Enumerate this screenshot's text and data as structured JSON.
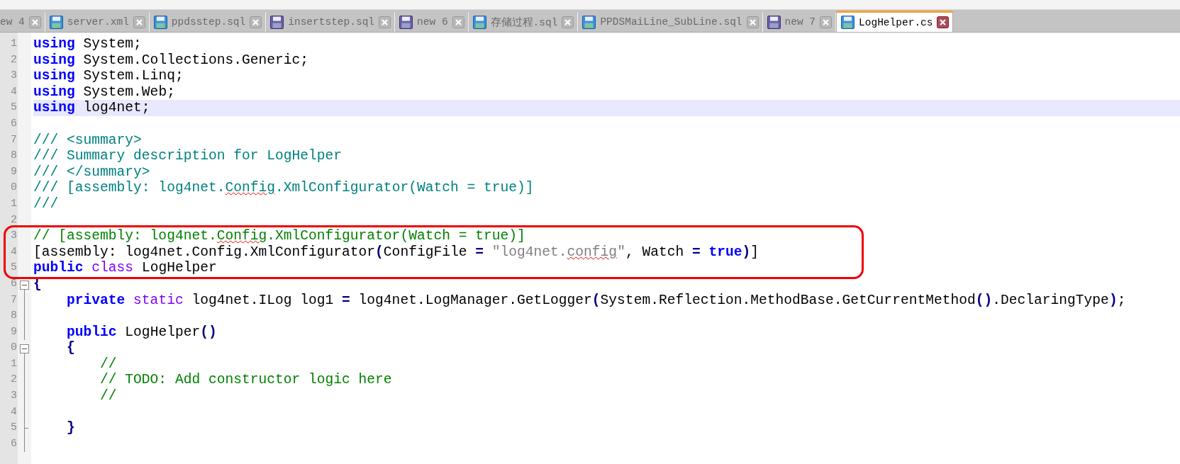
{
  "tabs": [
    {
      "label": "ew 4",
      "selected": false
    },
    {
      "label": "server.xml",
      "selected": false,
      "unsaved": false
    },
    {
      "label": "ppdsstep.sql",
      "selected": false,
      "unsaved": false
    },
    {
      "label": "insertstep.sql",
      "selected": false,
      "unsaved": true
    },
    {
      "label": "new 6",
      "selected": false,
      "unsaved": true
    },
    {
      "label": "存储过程.sql",
      "selected": false,
      "unsaved": false
    },
    {
      "label": "PPDSMaiLine_SubLine.sql",
      "selected": false,
      "unsaved": false
    },
    {
      "label": "new 7",
      "selected": false,
      "unsaved": true
    },
    {
      "label": "LogHelper.cs",
      "selected": true,
      "unsaved": false
    }
  ],
  "editor": {
    "lines": [
      {
        "number": "1",
        "tokens": [
          {
            "kind": "keyword",
            "text": "using"
          },
          {
            "kind": "plain",
            "text": " System;"
          }
        ]
      },
      {
        "number": "2",
        "tokens": [
          {
            "kind": "keyword",
            "text": "using"
          },
          {
            "kind": "plain",
            "text": " System.Collections.Generic;"
          }
        ]
      },
      {
        "number": "3",
        "tokens": [
          {
            "kind": "keyword",
            "text": "using"
          },
          {
            "kind": "plain",
            "text": " System.Linq;"
          }
        ]
      },
      {
        "number": "4",
        "tokens": [
          {
            "kind": "keyword",
            "text": "using"
          },
          {
            "kind": "plain",
            "text": " System.Web;"
          }
        ]
      },
      {
        "number": "5",
        "current": true,
        "tokens": [
          {
            "kind": "keyword",
            "text": "using"
          },
          {
            "kind": "plain",
            "text": " log4net;"
          }
        ]
      },
      {
        "number": "6"
      },
      {
        "number": "7",
        "tokens": [
          {
            "kind": "doc",
            "text": "/// <summary>"
          }
        ]
      },
      {
        "number": "8",
        "tokens": [
          {
            "kind": "doc",
            "text": "/// Summary description for LogHelper"
          }
        ]
      },
      {
        "number": "9",
        "tokens": [
          {
            "kind": "doc",
            "text": "/// </summary>"
          }
        ]
      },
      {
        "number": "0",
        "tokens": [
          {
            "kind": "doc",
            "text": "/// [assembly: log4net."
          },
          {
            "kind": "doc",
            "text": "Config",
            "misspelled": true
          },
          {
            "kind": "doc",
            "text": ".XmlConfigurator(Watch = true)]"
          }
        ]
      },
      {
        "number": "1",
        "tokens": [
          {
            "kind": "doc",
            "text": "///"
          }
        ]
      },
      {
        "number": "2"
      },
      {
        "number": "3",
        "boxed": true,
        "tokens": [
          {
            "kind": "comment",
            "text": "// [assembly: log4net."
          },
          {
            "kind": "comment",
            "text": "Config",
            "misspelled": true
          },
          {
            "kind": "comment",
            "text": ".XmlConfigurator(Watch = true)]"
          }
        ]
      },
      {
        "number": "4",
        "boxed": true,
        "tokens": [
          {
            "kind": "plain",
            "text": "[assembly: log4net.Config.XmlConfigurator"
          },
          {
            "kind": "op",
            "text": "("
          },
          {
            "kind": "plain",
            "text": "ConfigFile "
          },
          {
            "kind": "op",
            "text": "="
          },
          {
            "kind": "string",
            "text": " \"log4net."
          },
          {
            "kind": "string",
            "text": "config",
            "misspelled": true
          },
          {
            "kind": "string",
            "text": "\""
          },
          {
            "kind": "plain",
            "text": ", Watch "
          },
          {
            "kind": "op",
            "text": "="
          },
          {
            "kind": "keyword",
            "text": " true"
          },
          {
            "kind": "op",
            "text": ")"
          },
          {
            "kind": "plain",
            "text": "]"
          }
        ]
      },
      {
        "number": "5",
        "boxed": true,
        "tokens": [
          {
            "kind": "keyword",
            "text": "public"
          },
          {
            "kind": "type",
            "text": " class"
          },
          {
            "kind": "plain",
            "text": " LogHelper"
          }
        ]
      },
      {
        "number": "6",
        "fold_open": true,
        "tokens": [
          {
            "kind": "op",
            "text": "{"
          }
        ]
      },
      {
        "number": "7",
        "in_fold": true,
        "tokens": [
          {
            "kind": "keyword",
            "text": "    private"
          },
          {
            "kind": "type",
            "text": " static"
          },
          {
            "kind": "plain",
            "text": " log4net.ILog log1 "
          },
          {
            "kind": "op",
            "text": "="
          },
          {
            "kind": "plain",
            "text": " log4net.LogManager.GetLogger"
          },
          {
            "kind": "op",
            "text": "("
          },
          {
            "kind": "plain",
            "text": "System.Reflection.MethodBase.GetCurrentMethod"
          },
          {
            "kind": "op",
            "text": "()"
          },
          {
            "kind": "plain",
            "text": ".DeclaringType"
          },
          {
            "kind": "op",
            "text": ")"
          },
          {
            "kind": "plain",
            "text": ";"
          }
        ]
      },
      {
        "number": "8",
        "in_fold": true
      },
      {
        "number": "9",
        "in_fold": true,
        "tokens": [
          {
            "kind": "keyword",
            "text": "    public"
          },
          {
            "kind": "plain",
            "text": " LogHelper"
          },
          {
            "kind": "op",
            "text": "()"
          }
        ]
      },
      {
        "number": "0",
        "fold_open": true,
        "tokens": [
          {
            "kind": "op",
            "text": "    {"
          }
        ]
      },
      {
        "number": "1",
        "in_fold": true,
        "tokens": [
          {
            "kind": "comment",
            "text": "        //"
          }
        ]
      },
      {
        "number": "2",
        "in_fold": true,
        "tokens": [
          {
            "kind": "comment",
            "text": "        // TODO: Add constructor logic here"
          }
        ]
      },
      {
        "number": "3",
        "in_fold": true,
        "tokens": [
          {
            "kind": "comment",
            "text": "        //"
          }
        ]
      },
      {
        "number": "4",
        "in_fold": true
      },
      {
        "number": "5",
        "fold_end": true,
        "tokens": [
          {
            "kind": "op",
            "text": "    }"
          }
        ]
      },
      {
        "number": "6",
        "in_fold": true
      }
    ]
  }
}
